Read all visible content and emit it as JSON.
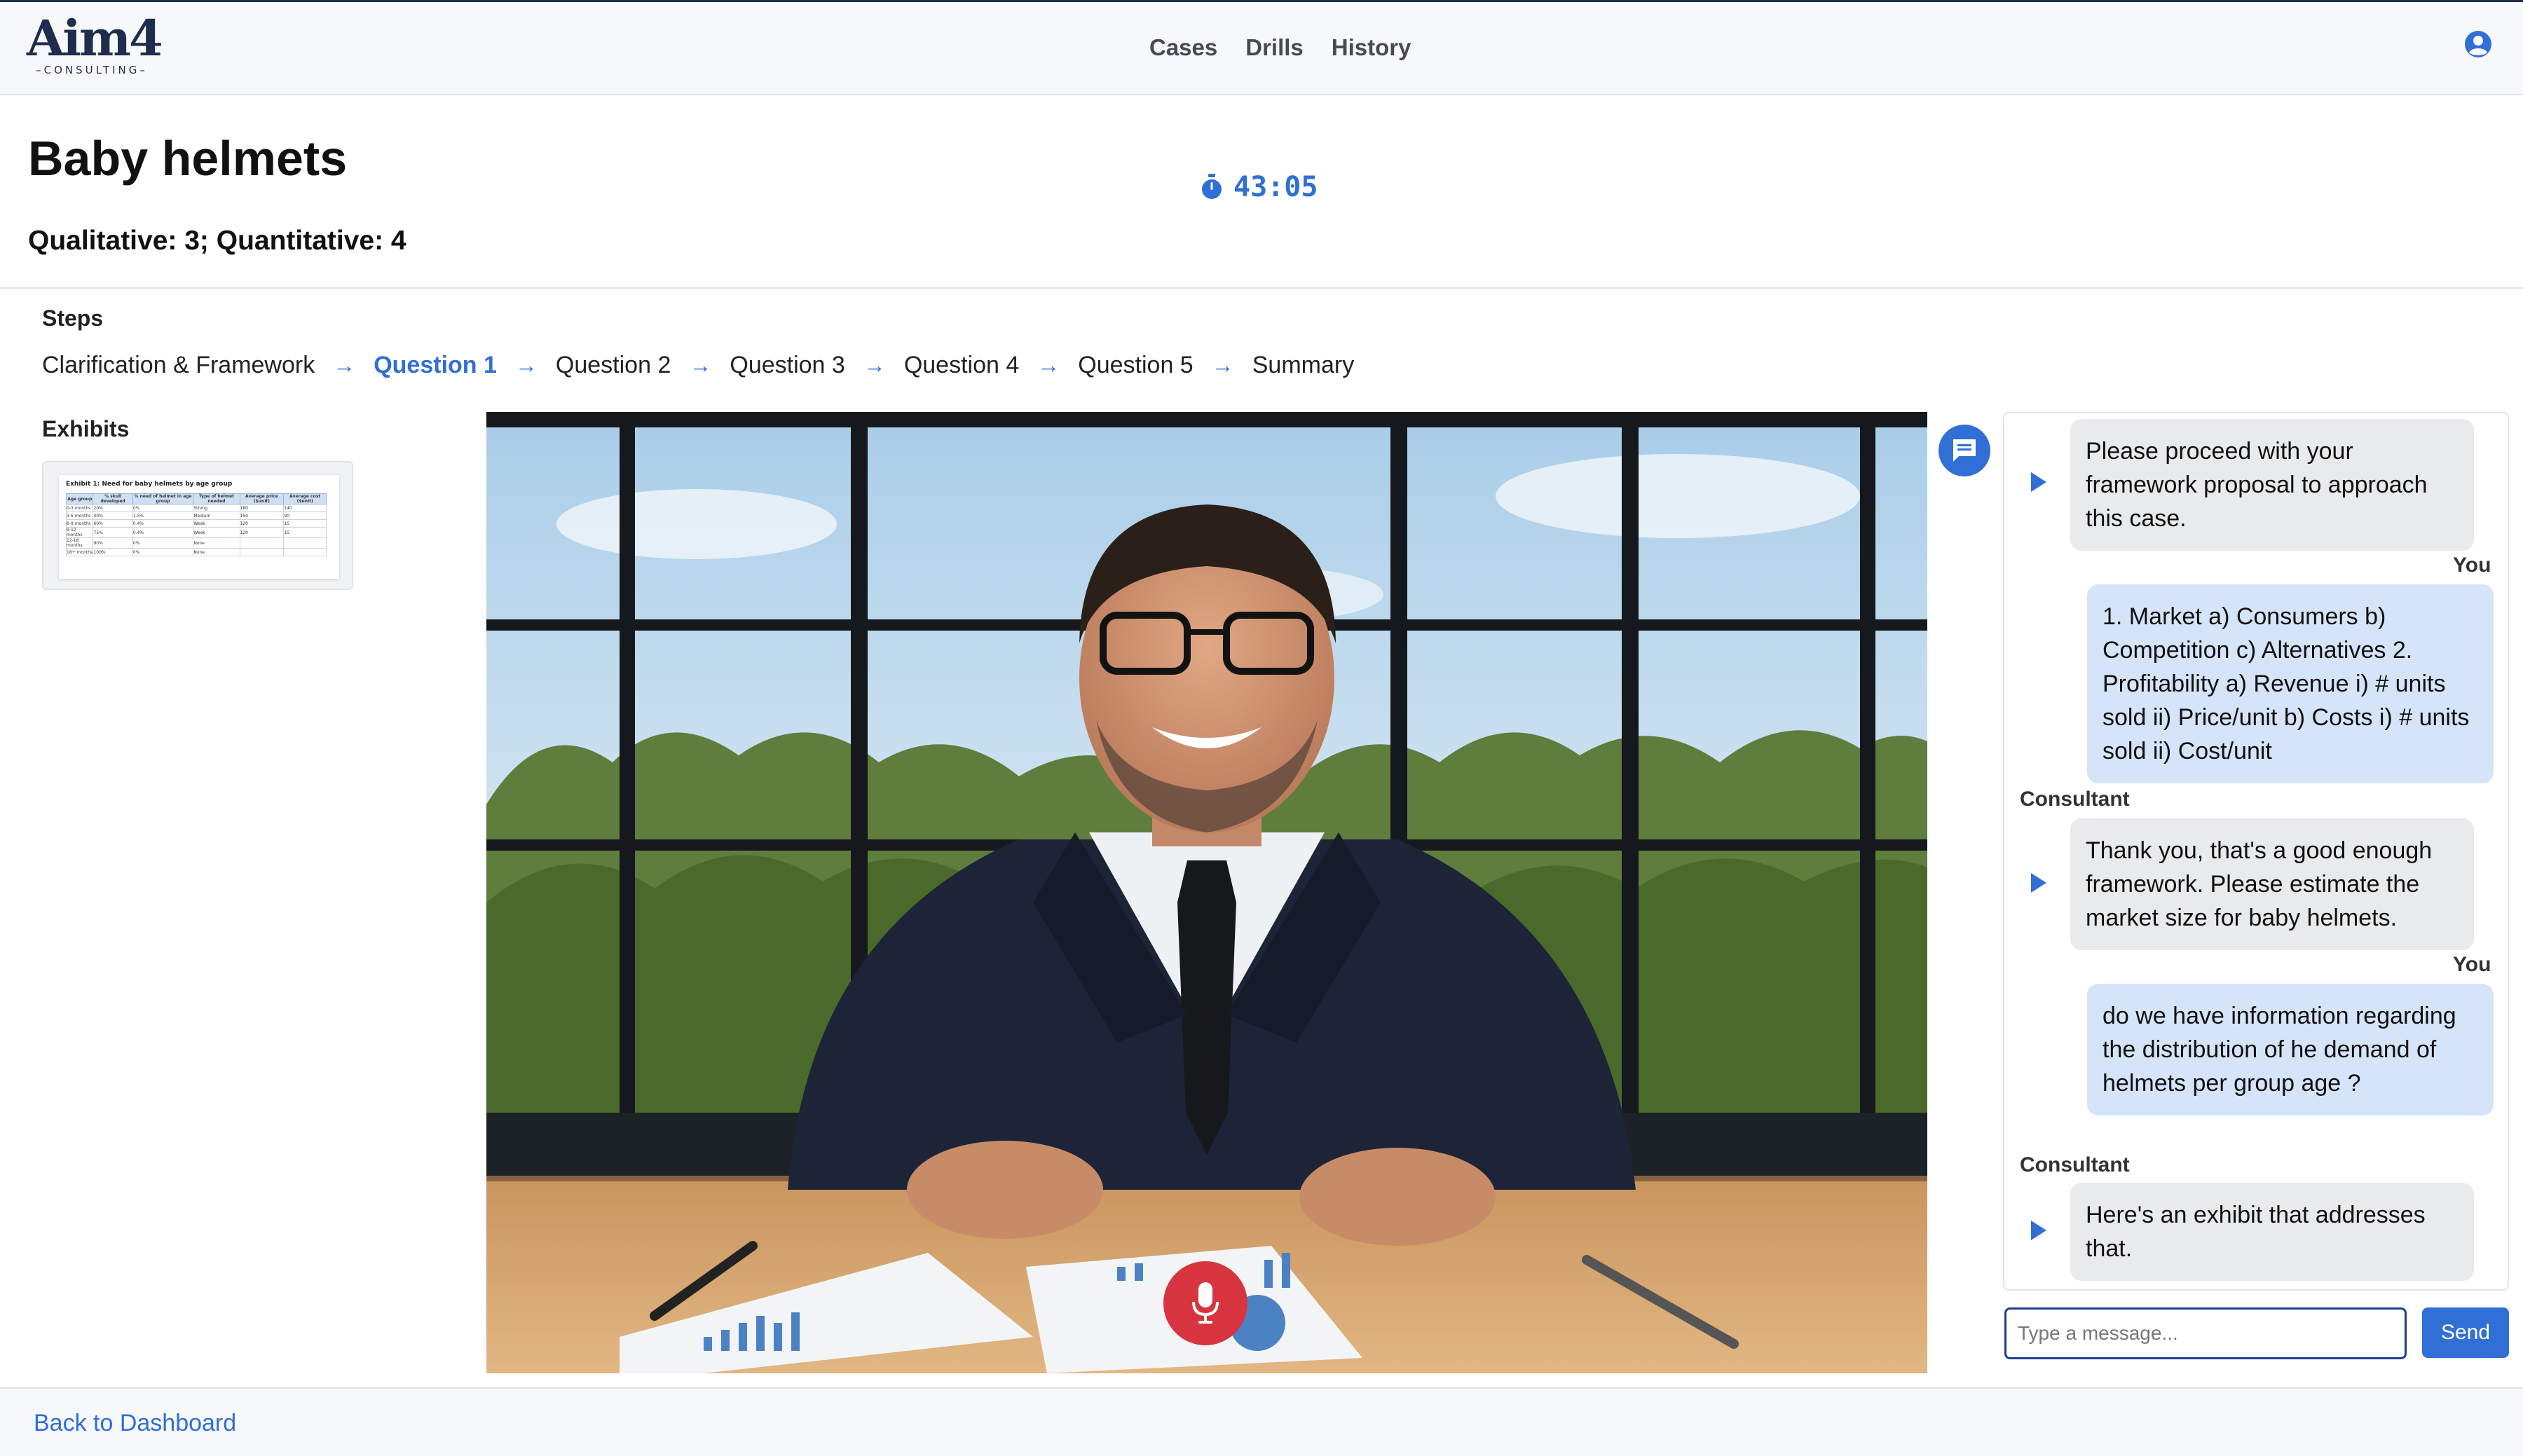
{
  "app": {
    "logo_text": "Aim4",
    "logo_sub": "CONSULTING"
  },
  "nav": {
    "items": [
      "Cases",
      "Drills",
      "History"
    ]
  },
  "case": {
    "title": "Baby helmets",
    "meta": "Qualitative: 3; Quantitative: 4",
    "timer": "43:05"
  },
  "steps": {
    "label": "Steps",
    "items": [
      "Clarification & Framework",
      "Question 1",
      "Question 2",
      "Question 3",
      "Question 4",
      "Question 5",
      "Summary"
    ],
    "active_index": 1
  },
  "exhibits": {
    "label": "Exhibits",
    "items": [
      {
        "title": "Exhibit 1: Need for baby helmets by age group",
        "headers": [
          "Age group",
          "% skull developed",
          "% need of helmet in age group",
          "Type of helmet needed",
          "Average price ($unit)",
          "Average cost ($unit)"
        ],
        "rows": [
          [
            "0-3 months",
            "20%",
            "0%",
            "Strong",
            "180",
            "140"
          ],
          [
            "3-6 months",
            "40%",
            "1.5%",
            "Medium",
            "150",
            "90"
          ],
          [
            "6-9 months",
            "60%",
            "0.4%",
            "Weak",
            "120",
            "15"
          ],
          [
            "9-12 months",
            "75%",
            "0.4%",
            "Weak",
            "120",
            "15"
          ],
          [
            "12-18 months",
            "90%",
            "0%",
            "None",
            "",
            ""
          ],
          [
            "18+ months",
            "100%",
            "0%",
            "None",
            "",
            ""
          ]
        ]
      }
    ]
  },
  "chat": {
    "messages": [
      {
        "role": "consultant",
        "sender": "",
        "text": "Please proceed with your framework proposal to approach this case."
      },
      {
        "role": "you",
        "sender": "You",
        "text": "1. Market a) Consumers b) Competition c) Alternatives 2. Profitability a) Revenue i) # units sold ii) Price/unit b) Costs i) # units sold ii) Cost/unit"
      },
      {
        "role": "consultant",
        "sender": "Consultant",
        "text": "Thank you, that's a good enough framework. Please estimate the market size for baby helmets."
      },
      {
        "role": "you",
        "sender": "You",
        "text": "do we have information regarding the distribution of he demand of helmets per group age ?"
      },
      {
        "role": "consultant",
        "sender": "Consultant",
        "text": "Here's an exhibit that addresses that."
      }
    ],
    "input_placeholder": "Type a message...",
    "send_label": "Send"
  },
  "footer": {
    "back_label": "Back to Dashboard"
  },
  "colors": {
    "accent": "#2f6fd6",
    "brand": "#1f2d4d",
    "mic": "#d8343f",
    "you_bubble": "#d5e4f9",
    "consultant_bubble": "#e9eaec"
  }
}
